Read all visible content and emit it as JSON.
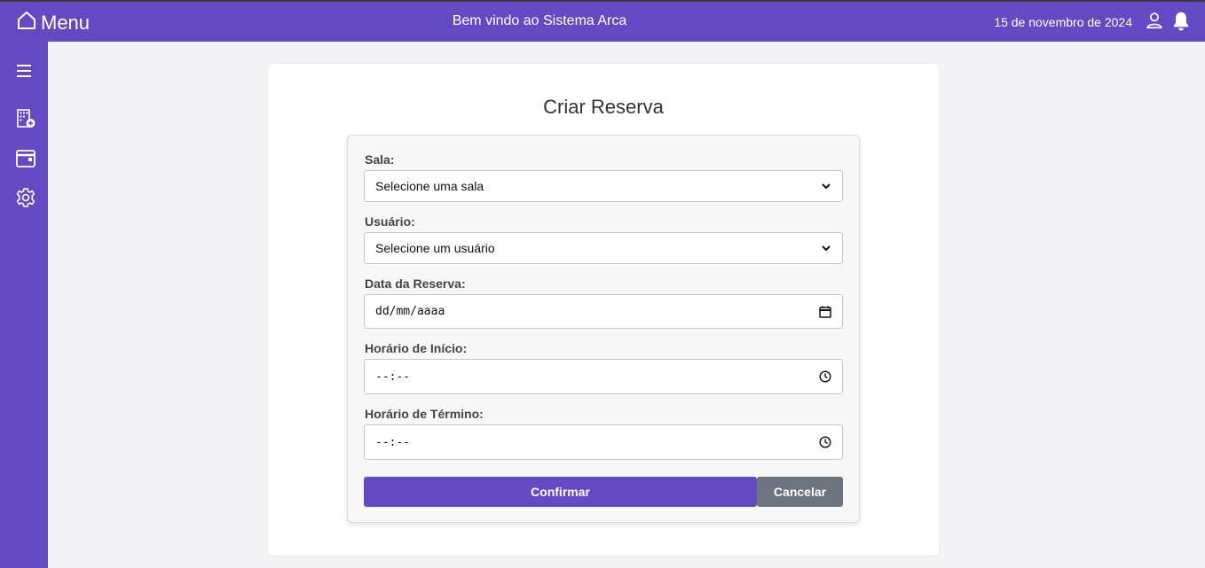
{
  "header": {
    "menu_label": "Menu",
    "welcome": "Bem vindo ao Sistema Arca",
    "date": "15 de novembro de 2024"
  },
  "sidebar": {
    "items": [
      {
        "icon": "hamburger-icon"
      },
      {
        "icon": "building-add-icon"
      },
      {
        "icon": "calendar-icon"
      },
      {
        "icon": "gear-icon"
      }
    ]
  },
  "page": {
    "title": "Criar Reserva"
  },
  "form": {
    "sala": {
      "label": "Sala:",
      "value": "Selecione uma sala"
    },
    "usuario": {
      "label": "Usuário:",
      "value": "Selecione um usuário"
    },
    "data": {
      "label": "Data da Reserva:",
      "value": "dd/mm/aaaa"
    },
    "inicio": {
      "label": "Horário de Início:",
      "value": "--:--"
    },
    "termino": {
      "label": "Horário de Término:",
      "value": "--:--"
    },
    "confirm_label": "Confirmar",
    "cancel_label": "Cancelar"
  },
  "colors": {
    "accent": "#6449c4",
    "secondary": "#6c757d",
    "background": "#f3f2f7"
  }
}
